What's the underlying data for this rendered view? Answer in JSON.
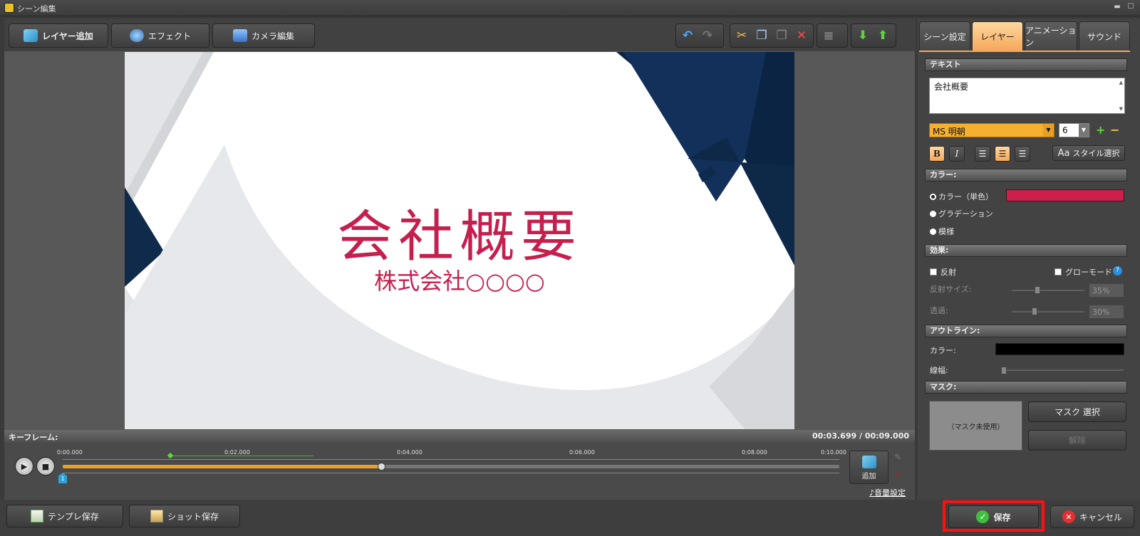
{
  "window": {
    "title": "シーン編集",
    "min": "▬",
    "max": "☐"
  },
  "toolbar": {
    "add_layer": "レイヤー追加",
    "effect": "エフェクト",
    "camera_edit": "カメラ編集"
  },
  "canvas": {
    "title": "会社概要",
    "subtitle": "株式会社○○○○"
  },
  "keyframe": {
    "label": "キーフレーム:",
    "current_time": "00:03.699",
    "separator": "/",
    "total_time": "00:09.000",
    "ticks": [
      "0:00.000",
      "0:02.000",
      "0:04.000",
      "0:06.000",
      "0:08.000",
      "0:10.000"
    ],
    "playhead_fraction": 0.411,
    "keyframe_marker": "1",
    "add": "追加",
    "volume": "音量設定"
  },
  "tabs": [
    "シーン設定",
    "レイヤー",
    "アニメーション",
    "サウンド"
  ],
  "text_section": {
    "header": "テキスト",
    "value": "会社概要",
    "font": "MS 明朝",
    "size": "6",
    "bold": "B",
    "italic": "I",
    "style_select": "スタイル選択",
    "aa": "Aa"
  },
  "color_section": {
    "header": "カラー:",
    "single": "カラー（単色）",
    "gradation": "グラデーション",
    "pattern": "模様",
    "color": "#cc1f4b"
  },
  "effect_section": {
    "header": "効果:",
    "reflection": "反射",
    "glow": "グローモード",
    "reflect_size": "反射サイズ:",
    "reflect_size_val": "35%",
    "transparency": "透過:",
    "transparency_val": "30%"
  },
  "outline_section": {
    "header": "アウトライン:",
    "color_label": "カラー:",
    "width_label": "線幅:",
    "color": "#000000"
  },
  "mask_section": {
    "header": "マスク:",
    "preview": "（マスク未使用）",
    "select": "マスク 選択",
    "remove": "解除"
  },
  "bottom": {
    "template_save": "テンプレ保存",
    "shot_save": "ショット保存",
    "save": "保存",
    "cancel": "キャンセル"
  }
}
